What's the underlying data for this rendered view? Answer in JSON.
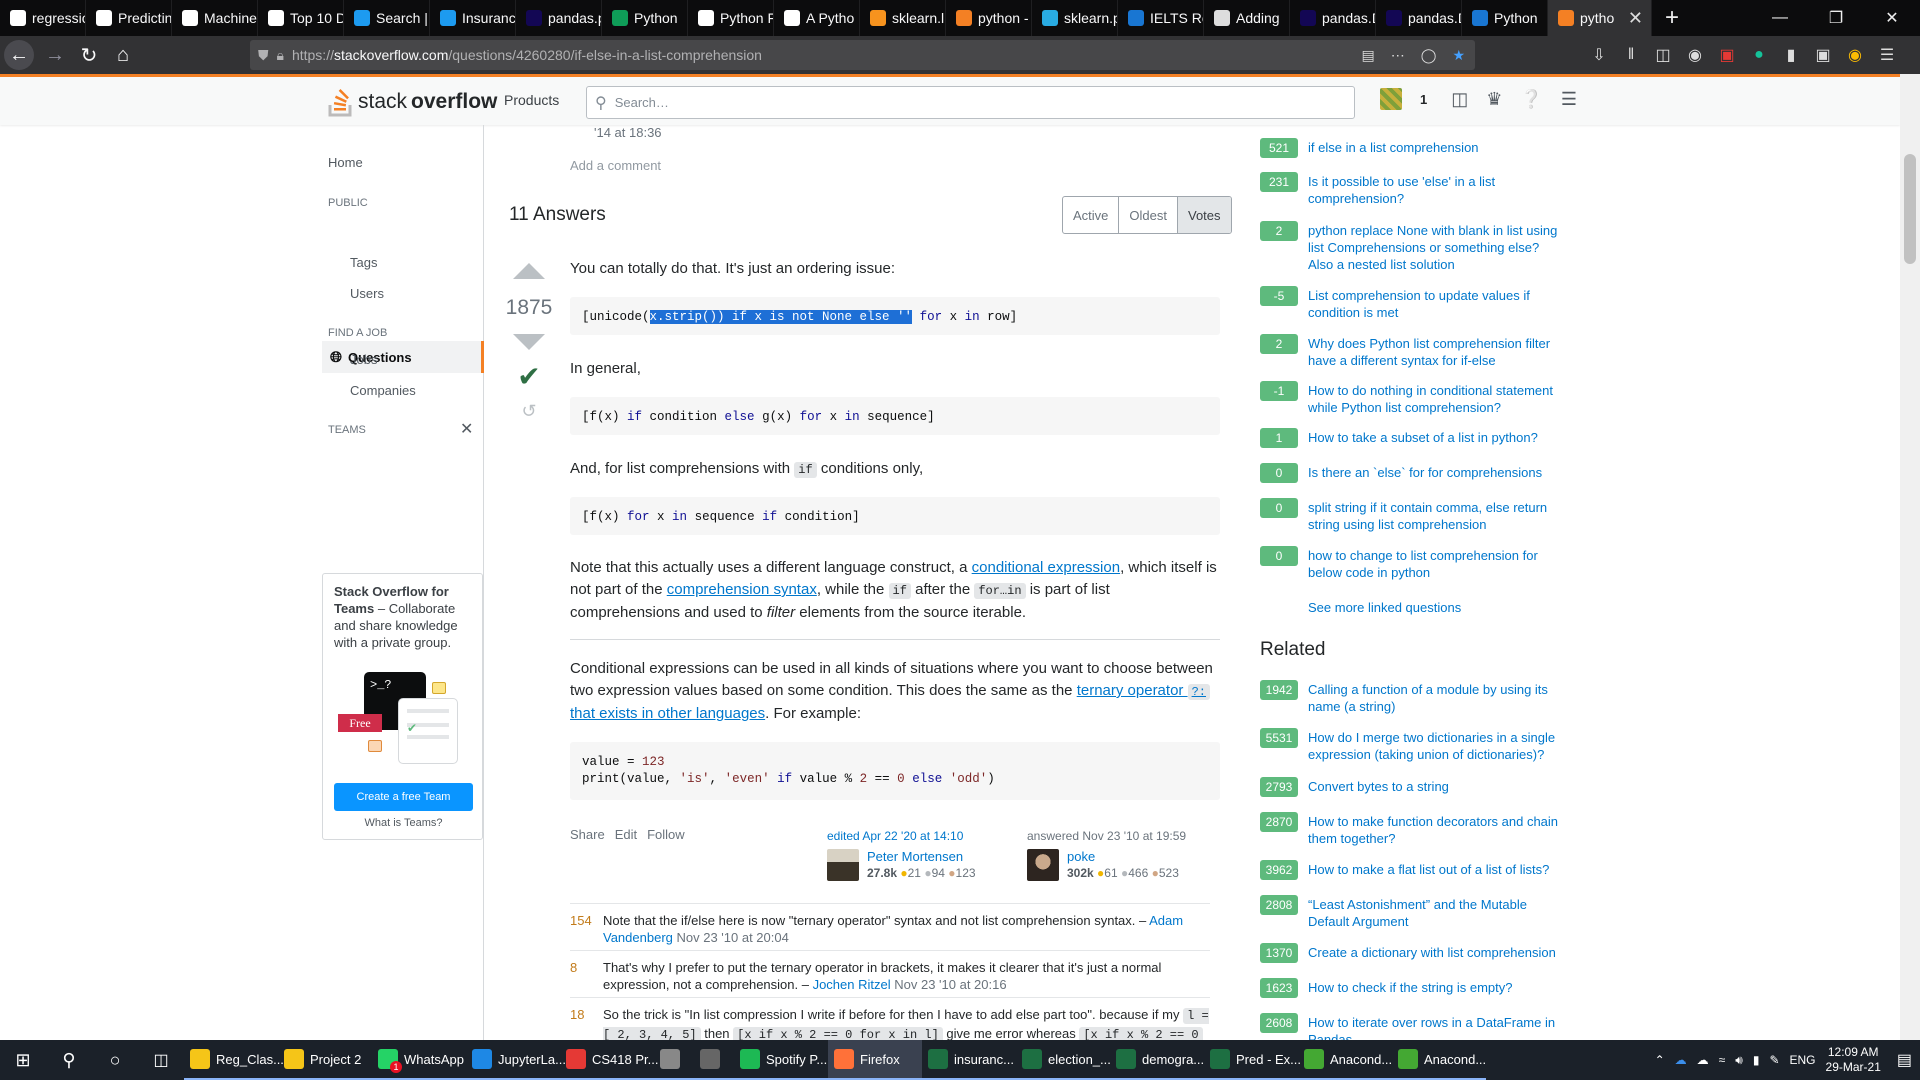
{
  "browser": {
    "tabs": [
      {
        "label": "regressio",
        "color": "#ffffff"
      },
      {
        "label": "Predictin",
        "color": "#ffffff"
      },
      {
        "label": "Machine",
        "color": "#ffffff"
      },
      {
        "label": "Top 10 D",
        "color": "#ffffff"
      },
      {
        "label": "Search |",
        "color": "#1d9bf0"
      },
      {
        "label": "Insuranc",
        "color": "#1d9bf0"
      },
      {
        "label": "pandas.p",
        "color": "#130754"
      },
      {
        "label": "Python",
        "color": "#0f9d58"
      },
      {
        "label": "Python F",
        "color": "#ffffff"
      },
      {
        "label": "A Pytho",
        "color": "#ffffff"
      },
      {
        "label": "sklearn.li",
        "color": "#f7931e"
      },
      {
        "label": "python -",
        "color": "#f48024"
      },
      {
        "label": "sklearn.p",
        "color": "#29abe2"
      },
      {
        "label": "IELTS Re",
        "color": "#1976d2"
      },
      {
        "label": "Adding",
        "color": "#dddddd"
      },
      {
        "label": "pandas.D",
        "color": "#130754"
      },
      {
        "label": "pandas.D",
        "color": "#130754"
      },
      {
        "label": "Python",
        "color": "#1976d2"
      }
    ],
    "active_tab": "pytho",
    "url_prefix": "https://",
    "url_host": "stackoverflow.com",
    "url_path": "/questions/4260280/if-else-in-a-list-comprehension"
  },
  "so": {
    "logo_stack": "stack",
    "logo_overflow": "overflow",
    "products": "Products",
    "search_placeholder": "Search…",
    "rep_count": "1"
  },
  "leftnav": {
    "home": "Home",
    "public": "PUBLIC",
    "questions": "Questions",
    "tags": "Tags",
    "users": "Users",
    "find_job": "FIND A JOB",
    "jobs": "Jobs",
    "companies": "Companies",
    "teams": "TEAMS",
    "teams_title": "Stack Overflow for Teams",
    "teams_text": " – Collaborate and share knowledge with a private group.",
    "free": "Free",
    "create_team": "Create a free Team",
    "what_is_teams": "What is Teams?"
  },
  "question": {
    "comment_date": "'14 at 18:36",
    "add_comment": "Add a comment"
  },
  "answers": {
    "count_label": "11 Answers",
    "sort_tabs": [
      "Active",
      "Oldest",
      "Votes"
    ]
  },
  "answer": {
    "votes": "1875",
    "p1": "You can totally do that. It's just an ordering issue:",
    "code1_pre": "[unicode(",
    "code1_sel": "x.strip()) if x is not None else ''",
    "code1_post1": " ",
    "code1_for": "for",
    "code1_post2": " x ",
    "code1_in": "in",
    "code1_post3": " row]",
    "p2": "In general,",
    "code2": {
      "a": "[f(x) ",
      "if": "if",
      "b": " condition ",
      "else": "else",
      "c": " g(x) ",
      "for": "for",
      "d": " x ",
      "in": "in",
      "e": " sequence]"
    },
    "p3_a": "And, for list comprehensions with ",
    "p3_code": "if",
    "p3_b": " conditions only,",
    "code3": {
      "a": "[f(x) ",
      "for": "for",
      "b": " x ",
      "in": "in",
      "c": " sequence ",
      "if": "if",
      "d": " condition]"
    },
    "p4_a": "Note that this actually uses a different language construct, a ",
    "p4_link1": "conditional expression",
    "p4_b": ", which itself is not part of the ",
    "p4_link2": "comprehension syntax",
    "p4_c": ", while the ",
    "p4_code1": "if",
    "p4_d": " after the ",
    "p4_code2": "for…in",
    "p4_e": " is part of list comprehensions and used to ",
    "p4_em": "filter",
    "p4_f": " elements from the source iterable.",
    "p5_a": "Conditional expressions can be used in all kinds of situations where you want to choose between two expression values based on some condition. This does the same as the ",
    "p5_link": "ternary operator ",
    "p5_code": "?:",
    "p5_link2": "that exists in other languages",
    "p5_b": ". For example:",
    "code4_l1": {
      "a": "value = ",
      "num": "123"
    },
    "code4_l2": {
      "a": "print(value, ",
      "s1": "'is'",
      "b": ", ",
      "s2": "'even'",
      "c": " ",
      "if": "if",
      "d": " value % ",
      "n1": "2",
      "e": " == ",
      "n2": "0",
      "f": " ",
      "else": "else",
      "g": " ",
      "s3": "'odd'",
      "h": ")"
    },
    "share": "Share",
    "edit": "Edit",
    "follow": "Follow",
    "edited": "edited Apr 22 '20 at 14:10",
    "editor": "Peter Mortensen",
    "editor_rep": "27.8k",
    "editor_gold": "21",
    "editor_silver": "94",
    "editor_bronze": "123",
    "answered": "answered Nov 23 '10 at 19:59",
    "author": "poke",
    "author_rep": "302k",
    "author_gold": "61",
    "author_silver": "466",
    "author_bronze": "523"
  },
  "comments": [
    {
      "score": "154",
      "text": "Note that the if/else here is now \"ternary operator\" syntax and not list comprehension syntax. – ",
      "user": "Adam Vandenberg",
      "date": " Nov 23 '10 at 20:04"
    },
    {
      "score": "8",
      "text": "That's why I prefer to put the ternary operator in brackets, it makes it clearer that it's just a normal expression, not a comprehension. – ",
      "user": "Jochen Ritzel",
      "date": " Nov 23 '10 at 20:16"
    },
    {
      "score": "18",
      "text": "So the trick is \"In list compression I write if before for then I have to add else part too\". because if my ",
      "code1": "l = [ 2, 3, 4, 5]",
      "text2": " then ",
      "code2": "[x if x % 2 == 0 for x in l]",
      "text3": " give me error whereas ",
      "code3": "[x if x % 2 == 0"
    }
  ],
  "linked": [
    {
      "score": "521",
      "title": "if else in a list comprehension"
    },
    {
      "score": "231",
      "title": "Is it possible to use 'else' in a list comprehension?"
    },
    {
      "score": "2",
      "title": "python replace None with blank in list using list Comprehensions or something else? Also a nested list solution"
    },
    {
      "score": "-5",
      "title": "List comprehension to update values if condition is met"
    },
    {
      "score": "2",
      "title": "Why does Python list comprehension filter have a different syntax for if-else"
    },
    {
      "score": "-1",
      "title": "How to do nothing in conditional statement while Python list comprehension?"
    },
    {
      "score": "1",
      "title": "How to take a subset of a list in python?"
    },
    {
      "score": "0",
      "title": "Is there an `else` for for comprehensions"
    },
    {
      "score": "0",
      "title": "split string if it contain comma, else return string using list comprehension"
    },
    {
      "score": "0",
      "title": "how to change to list comprehension for below code in python"
    }
  ],
  "see_more_linked": "See more linked questions",
  "related_heading": "Related",
  "related": [
    {
      "score": "1942",
      "title": "Calling a function of a module by using its name (a string)"
    },
    {
      "score": "5531",
      "title": "How do I merge two dictionaries in a single expression (taking union of dictionaries)?"
    },
    {
      "score": "2793",
      "title": "Convert bytes to a string"
    },
    {
      "score": "2870",
      "title": "How to make function decorators and chain them together?"
    },
    {
      "score": "3962",
      "title": "How to make a flat list out of a list of lists?"
    },
    {
      "score": "2808",
      "title": "“Least Astonishment” and the Mutable Default Argument"
    },
    {
      "score": "1370",
      "title": "Create a dictionary with list comprehension"
    },
    {
      "score": "1623",
      "title": "How to check if the string is empty?"
    },
    {
      "score": "2608",
      "title": "How to iterate over rows in a DataFrame in Pandas"
    }
  ],
  "taskbar": {
    "apps": [
      {
        "label": "Reg_Clas...",
        "color": "#f5c518"
      },
      {
        "label": "Project 2",
        "color": "#f5c518"
      },
      {
        "label": "WhatsApp",
        "color": "#25d366"
      },
      {
        "label": "JupyterLa...",
        "color": "#1e88e5"
      },
      {
        "label": "CS418 Pr...",
        "color": "#e53935"
      },
      {
        "label": "",
        "color": "#888888"
      },
      {
        "label": "",
        "color": "#666666"
      },
      {
        "label": "Spotify P...",
        "color": "#1db954"
      },
      {
        "label": "Firefox",
        "color": "#ff7139"
      },
      {
        "label": "insuranc...",
        "color": "#1d6f42"
      },
      {
        "label": "election_...",
        "color": "#1d6f42"
      },
      {
        "label": "demogra...",
        "color": "#1d6f42"
      },
      {
        "label": "Pred - Ex...",
        "color": "#1d6f42"
      },
      {
        "label": "Anacond...",
        "color": "#44a833"
      },
      {
        "label": "Anacond...",
        "color": "#44a833"
      }
    ],
    "whatsapp_badge": "1",
    "lang": "ENG",
    "time": "12:09 AM",
    "date": "29-Mar-21"
  }
}
